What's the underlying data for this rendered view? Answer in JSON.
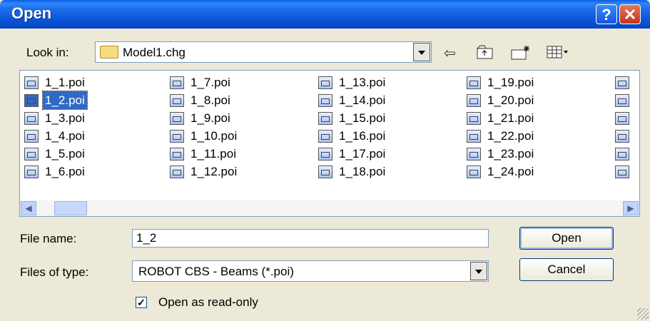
{
  "window": {
    "title": "Open",
    "help_glyph": "?",
    "close_glyph": "✕"
  },
  "toolbar": {
    "look_in_label": "Look in:",
    "look_in_value": "Model1.chg",
    "icons": [
      "back-arrow-icon",
      "up-folder-icon",
      "new-folder-icon",
      "views-menu-icon"
    ]
  },
  "files": {
    "columns": [
      [
        "1_1.poi",
        "1_2.poi",
        "1_3.poi",
        "1_4.poi",
        "1_5.poi",
        "1_6.poi"
      ],
      [
        "1_7.poi",
        "1_8.poi",
        "1_9.poi",
        "1_10.poi",
        "1_11.poi",
        "1_12.poi"
      ],
      [
        "1_13.poi",
        "1_14.poi",
        "1_15.poi",
        "1_16.poi",
        "1_17.poi",
        "1_18.poi"
      ],
      [
        "1_19.poi",
        "1_20.poi",
        "1_21.poi",
        "1_22.poi",
        "1_23.poi",
        "1_24.poi"
      ]
    ],
    "selected": "1_2.poi"
  },
  "form": {
    "file_name_label": "File name:",
    "file_name_value": "1_2",
    "files_of_type_label": "Files of type:",
    "files_of_type_value": "ROBOT CBS - Beams (*.poi)",
    "read_only_label": "Open as read-only",
    "read_only_checked": true
  },
  "buttons": {
    "open": "Open",
    "cancel": "Cancel"
  }
}
